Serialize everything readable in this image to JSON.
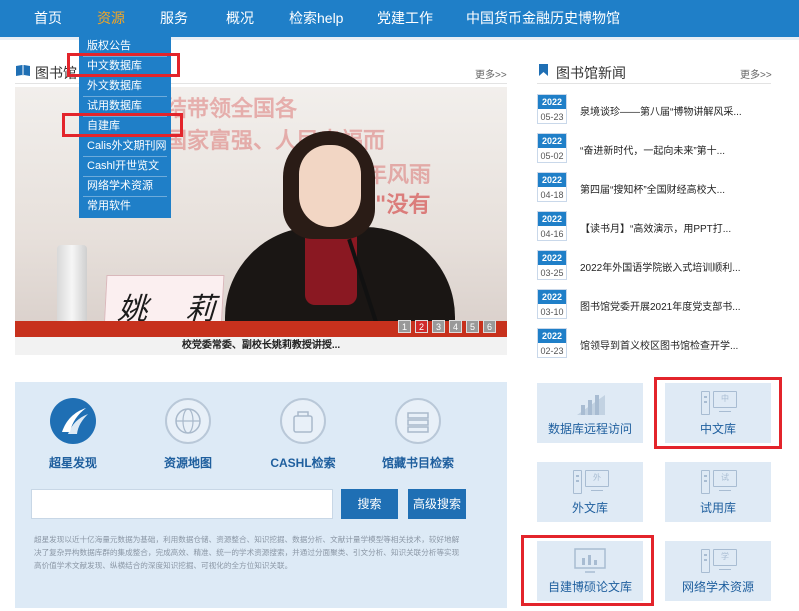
{
  "nav": {
    "items": [
      "首页",
      "资源",
      "服务",
      "概况",
      "检索help",
      "党建工作",
      "中国货币金融历史博物馆"
    ],
    "active_index": 1
  },
  "dropdown": {
    "items": [
      "版权公告",
      "中文数据库",
      "外文数据库",
      "试用数据库",
      "自建库",
      "Calis外文期刊网",
      "Cashl开世览文",
      "网络学术资源",
      "常用软件"
    ]
  },
  "library_section": {
    "title": "图书馆",
    "more": "更多>>"
  },
  "slideshow": {
    "caption": "校党委常委、副校长姚莉教授讲授...",
    "nameplate": "姚 莉",
    "pages": [
      "1",
      "2",
      "3",
      "4",
      "5",
      "6"
    ],
    "active_page": 2
  },
  "news": {
    "title": "图书馆新闻",
    "more": "更多>>",
    "items": [
      {
        "year": "2022",
        "date": "05-23",
        "title": "泉境谈珍——第八届“博物讲解风采..."
      },
      {
        "year": "2022",
        "date": "05-02",
        "title": "“奋进新时代，一起向未来”第十..."
      },
      {
        "year": "2022",
        "date": "04-18",
        "title": "第四届“搜知杯”全国财经高校大..."
      },
      {
        "year": "2022",
        "date": "04-16",
        "title": "【读书月】“高效演示，用PPT打..."
      },
      {
        "year": "2022",
        "date": "03-25",
        "title": "2022年外国语学院嵌入式培训顺利..."
      },
      {
        "year": "2022",
        "date": "03-10",
        "title": "图书馆党委开展2021年度党支部书..."
      },
      {
        "year": "2022",
        "date": "02-23",
        "title": "馆领导到首义校区图书馆检查开学..."
      }
    ]
  },
  "search": {
    "tools": [
      "超星发现",
      "资源地图",
      "CASHL检索",
      "馆藏书目检索"
    ],
    "input_value": "",
    "search_label": "搜索",
    "advanced_label": "高级搜索",
    "description": "超星发现以近十亿海量元数据为基础，利用数据仓储、资源整合、知识挖掘、数据分析、文献计量学模型等相关技术，较好地解决了复杂异构数据库群的集成整合，完成高效、精准、统一的学术资源搜索，并通过分面聚类、引文分析、知识关联分析等实现高价值学术文献发现、纵横结合的深度知识挖掘、可视化的全方位知识关联。"
  },
  "tiles": {
    "remote": "数据库远程访问",
    "chinese": "中文库",
    "foreign": "外文库",
    "trial": "试用库",
    "thesis": "自建博硕论文库",
    "web": "网络学术资源",
    "glyph_foreign": "外",
    "glyph_trial": "试",
    "glyph_chinese": "中",
    "glyph_web": "学"
  },
  "colors": {
    "nav": "#1f7fc8",
    "active": "#f5a623",
    "highlight": "#e3242b",
    "tile": "#dfeaf5"
  }
}
